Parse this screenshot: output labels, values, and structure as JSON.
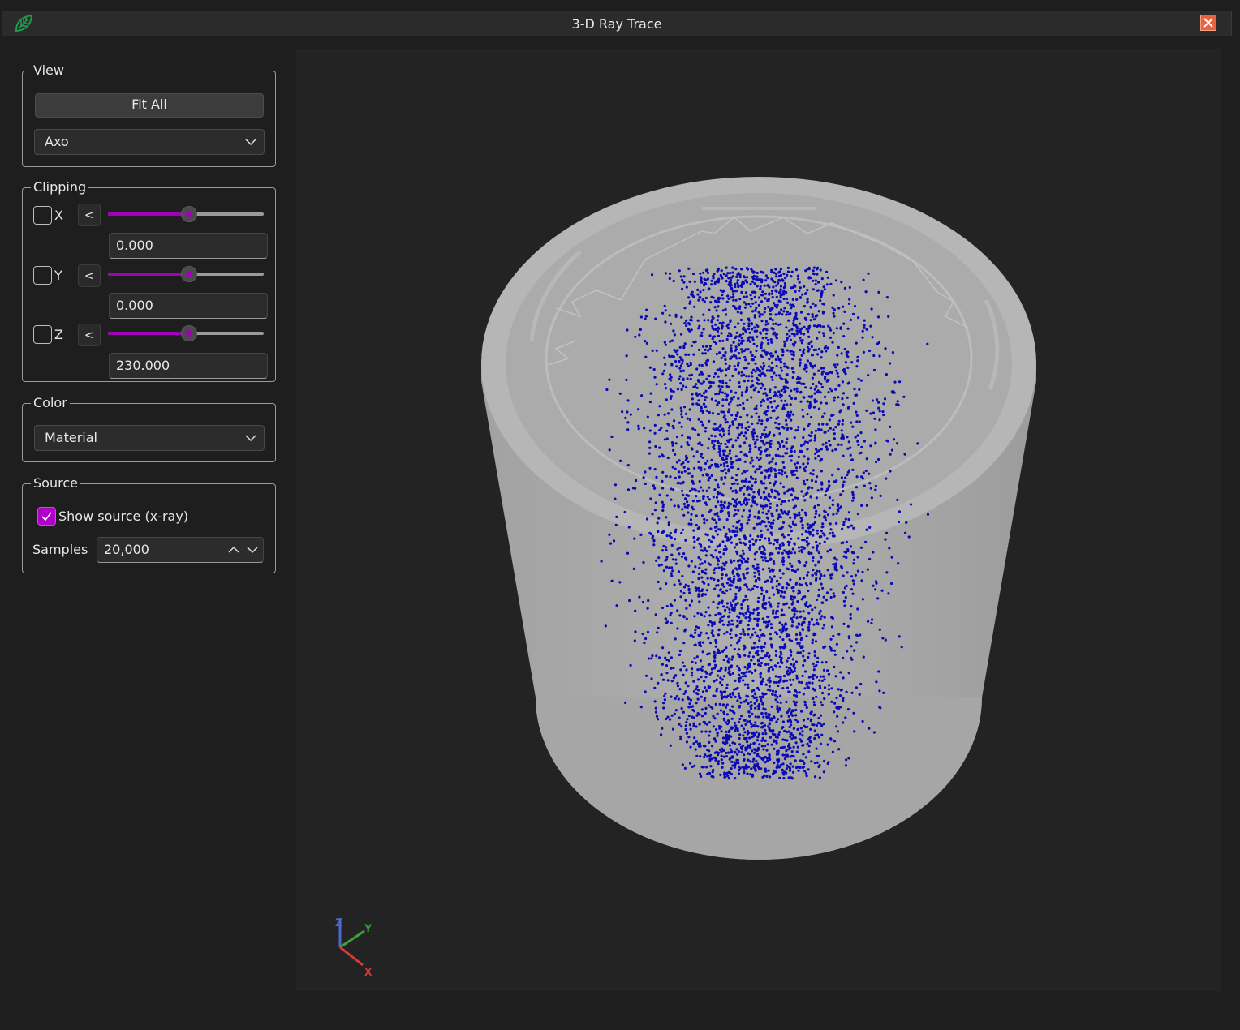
{
  "window": {
    "title": "3-D Ray Trace",
    "app_icon": "leaf-app-icon",
    "close_icon": "close-icon"
  },
  "view": {
    "legend": "View",
    "fit_all_label": "Fit All",
    "projection": "Axo"
  },
  "clipping": {
    "legend": "Clipping",
    "axes": [
      {
        "label": "X",
        "checked": false,
        "button": "<",
        "slider_fraction": 0.52,
        "value": "0.000"
      },
      {
        "label": "Y",
        "checked": false,
        "button": "<",
        "slider_fraction": 0.52,
        "value": "0.000"
      },
      {
        "label": "Z",
        "checked": false,
        "button": "<",
        "slider_fraction": 0.52,
        "value": "230.000"
      }
    ]
  },
  "color": {
    "legend": "Color",
    "mode": "Material"
  },
  "source": {
    "legend": "Source",
    "show_source_label": "Show source (x-ray)",
    "show_source_checked": true,
    "samples_label": "Samples",
    "samples_value": "20,000"
  },
  "triad": {
    "x": "X",
    "y": "Y",
    "z": "Z"
  },
  "colors": {
    "accent": "#a000b8",
    "points": "#0a0ab4",
    "cylinder": "#a4a4a4",
    "axis_x": "#d23c3c",
    "axis_y": "#3ca03c",
    "axis_z": "#4a6ad0"
  }
}
